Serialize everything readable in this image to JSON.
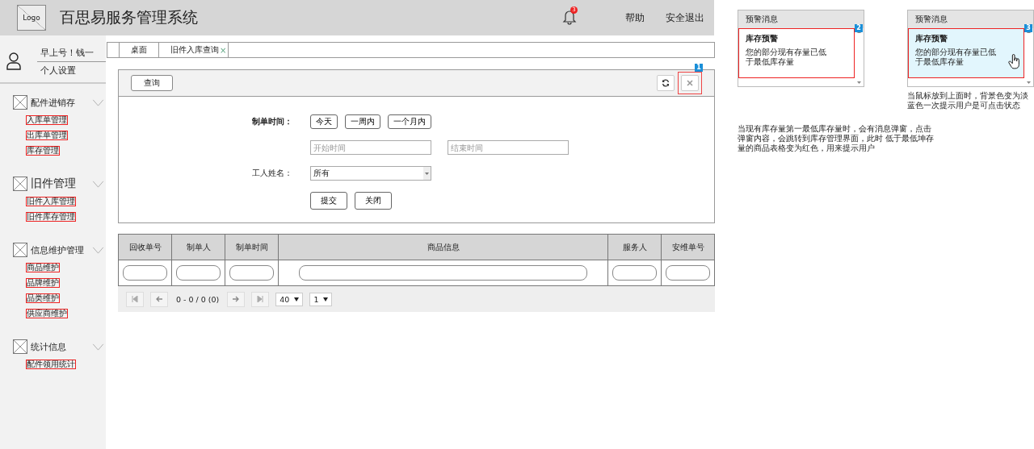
{
  "header": {
    "logo": "Logo",
    "title": "百思易服务管理系统",
    "notification_count": "3",
    "links": [
      "帮助",
      "安全退出"
    ]
  },
  "user": {
    "greeting": "早上号！钱一",
    "settings": "个人设置"
  },
  "sidebar": {
    "groups": [
      {
        "title": "配件进销存",
        "emphasized": false,
        "items": [
          "入库单管理",
          "出库单管理",
          "库存管理"
        ]
      },
      {
        "title": "旧件管理",
        "emphasized": true,
        "items": [
          "旧件入库管理",
          "旧件库存管理"
        ]
      },
      {
        "title": "信息维护管理",
        "emphasized": false,
        "items": [
          "商品维护",
          "品牌维护",
          "品类维护",
          "供应商维护"
        ]
      },
      {
        "title": "统计信息",
        "emphasized": false,
        "items": [
          "配件领用统计"
        ]
      }
    ]
  },
  "tabs": [
    {
      "label": "桌面"
    },
    {
      "label": "旧件入库查询",
      "close_glyph": "×"
    }
  ],
  "panel": {
    "tab": "查询",
    "marker": "1"
  },
  "form": {
    "date_label": "制单时间：",
    "quick_ranges": [
      "今天",
      "一周内",
      "一个月内"
    ],
    "start_placeholder": "开始时间",
    "end_placeholder": "结束时间",
    "worker_label": "工人姓名：",
    "worker_value": "所有",
    "actions": [
      "提交",
      "关闭"
    ]
  },
  "table": {
    "columns": [
      "回收单号",
      "制单人",
      "制单时间",
      "商品信息",
      "服务人",
      "安维单号"
    ]
  },
  "pager": {
    "range": "0 - 0 / 0 (0)",
    "page_size": "40",
    "page": "1"
  },
  "popups": [
    {
      "title": "预警消息",
      "heading": "库存预警",
      "body": "您的部分现有存量已低于最低库存量",
      "marker": "2",
      "hovered": false
    },
    {
      "title": "预警消息",
      "heading": "库存预警",
      "body": "您的部分现有存量已低于最低库存量",
      "marker": "3",
      "hovered": true,
      "note": "当鼠标放到上面时，背景色变为淡蓝色一次提示用户是可点击状态"
    }
  ],
  "note": "当现有库存量第一最低库存量时，会有消息弹窗，点击弹窗内容，会跳转到库存管理界面，此时 低于最低坤存量的商品表格变为红色，用来提示用户"
}
